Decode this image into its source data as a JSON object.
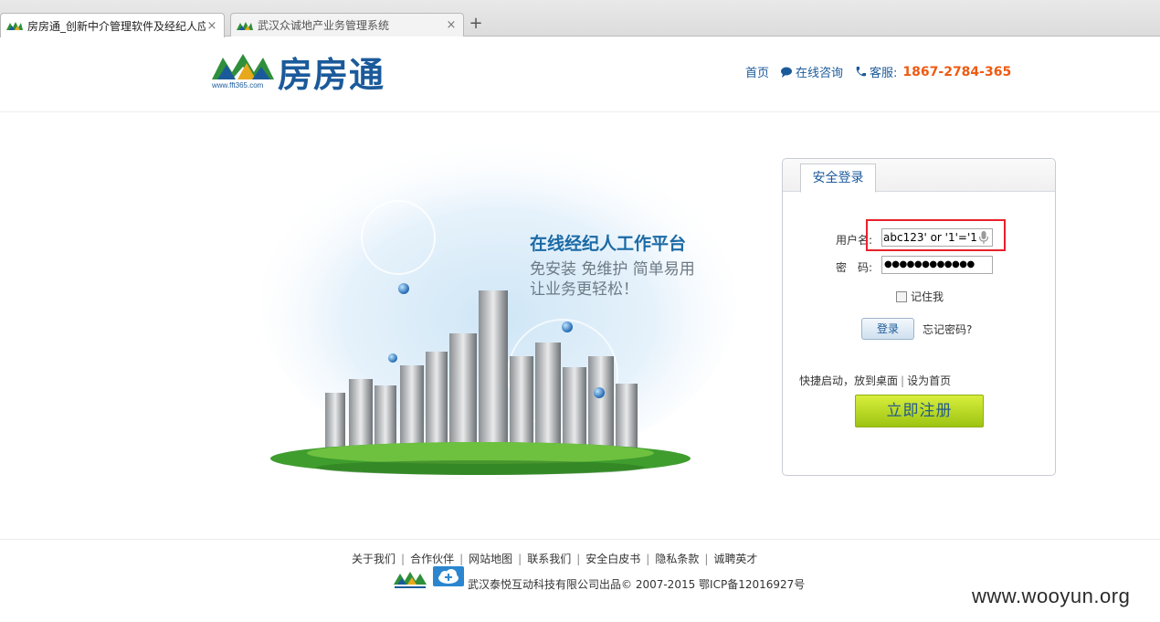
{
  "browser": {
    "tabs": [
      {
        "title": "房房通_创新中介管理软件及经纪人应",
        "close": "×"
      },
      {
        "title": "武汉众诚地产业务管理系统",
        "close": "×"
      }
    ],
    "new_tab": "+"
  },
  "header": {
    "logo_text": "房房通",
    "logo_url": "www.fft365.com",
    "nav": {
      "home": "首页",
      "online_consult": "在线咨询",
      "service_label": "客服:",
      "service_phone": "1867-2784-365"
    }
  },
  "hero": {
    "slogan_title": "在线经纪人工作平台",
    "slogan_line1": "免安装 免维护 简单易用",
    "slogan_line2": "让业务更轻松！"
  },
  "login": {
    "tab_label": "安全登录",
    "username_label": "用户名:",
    "username_value": "abc123' or '1'='1",
    "password_label": "密　码:",
    "password_value": "●●●●●●●●●●●●",
    "remember_label": "记住我",
    "login_button": "登录",
    "forgot_password": "忘记密码?",
    "shortcut_launch": "快捷启动，放到桌面",
    "set_homepage": "设为首页",
    "register_button": "立即注册"
  },
  "footer": {
    "links": [
      "关于我们",
      "合作伙伴",
      "网站地图",
      "联系我们",
      "安全白皮书",
      "隐私条款",
      "诚聘英才"
    ],
    "copyright": "武汉泰悦互动科技有限公司出品© 2007-2015 鄂ICP备12016927号"
  },
  "watermark": "www.wooyun.org",
  "colors": {
    "brand_blue": "#1b5a9a",
    "phone_orange": "#ef5a12",
    "highlight_red": "#e8212a",
    "register_green": "#9dc412"
  }
}
